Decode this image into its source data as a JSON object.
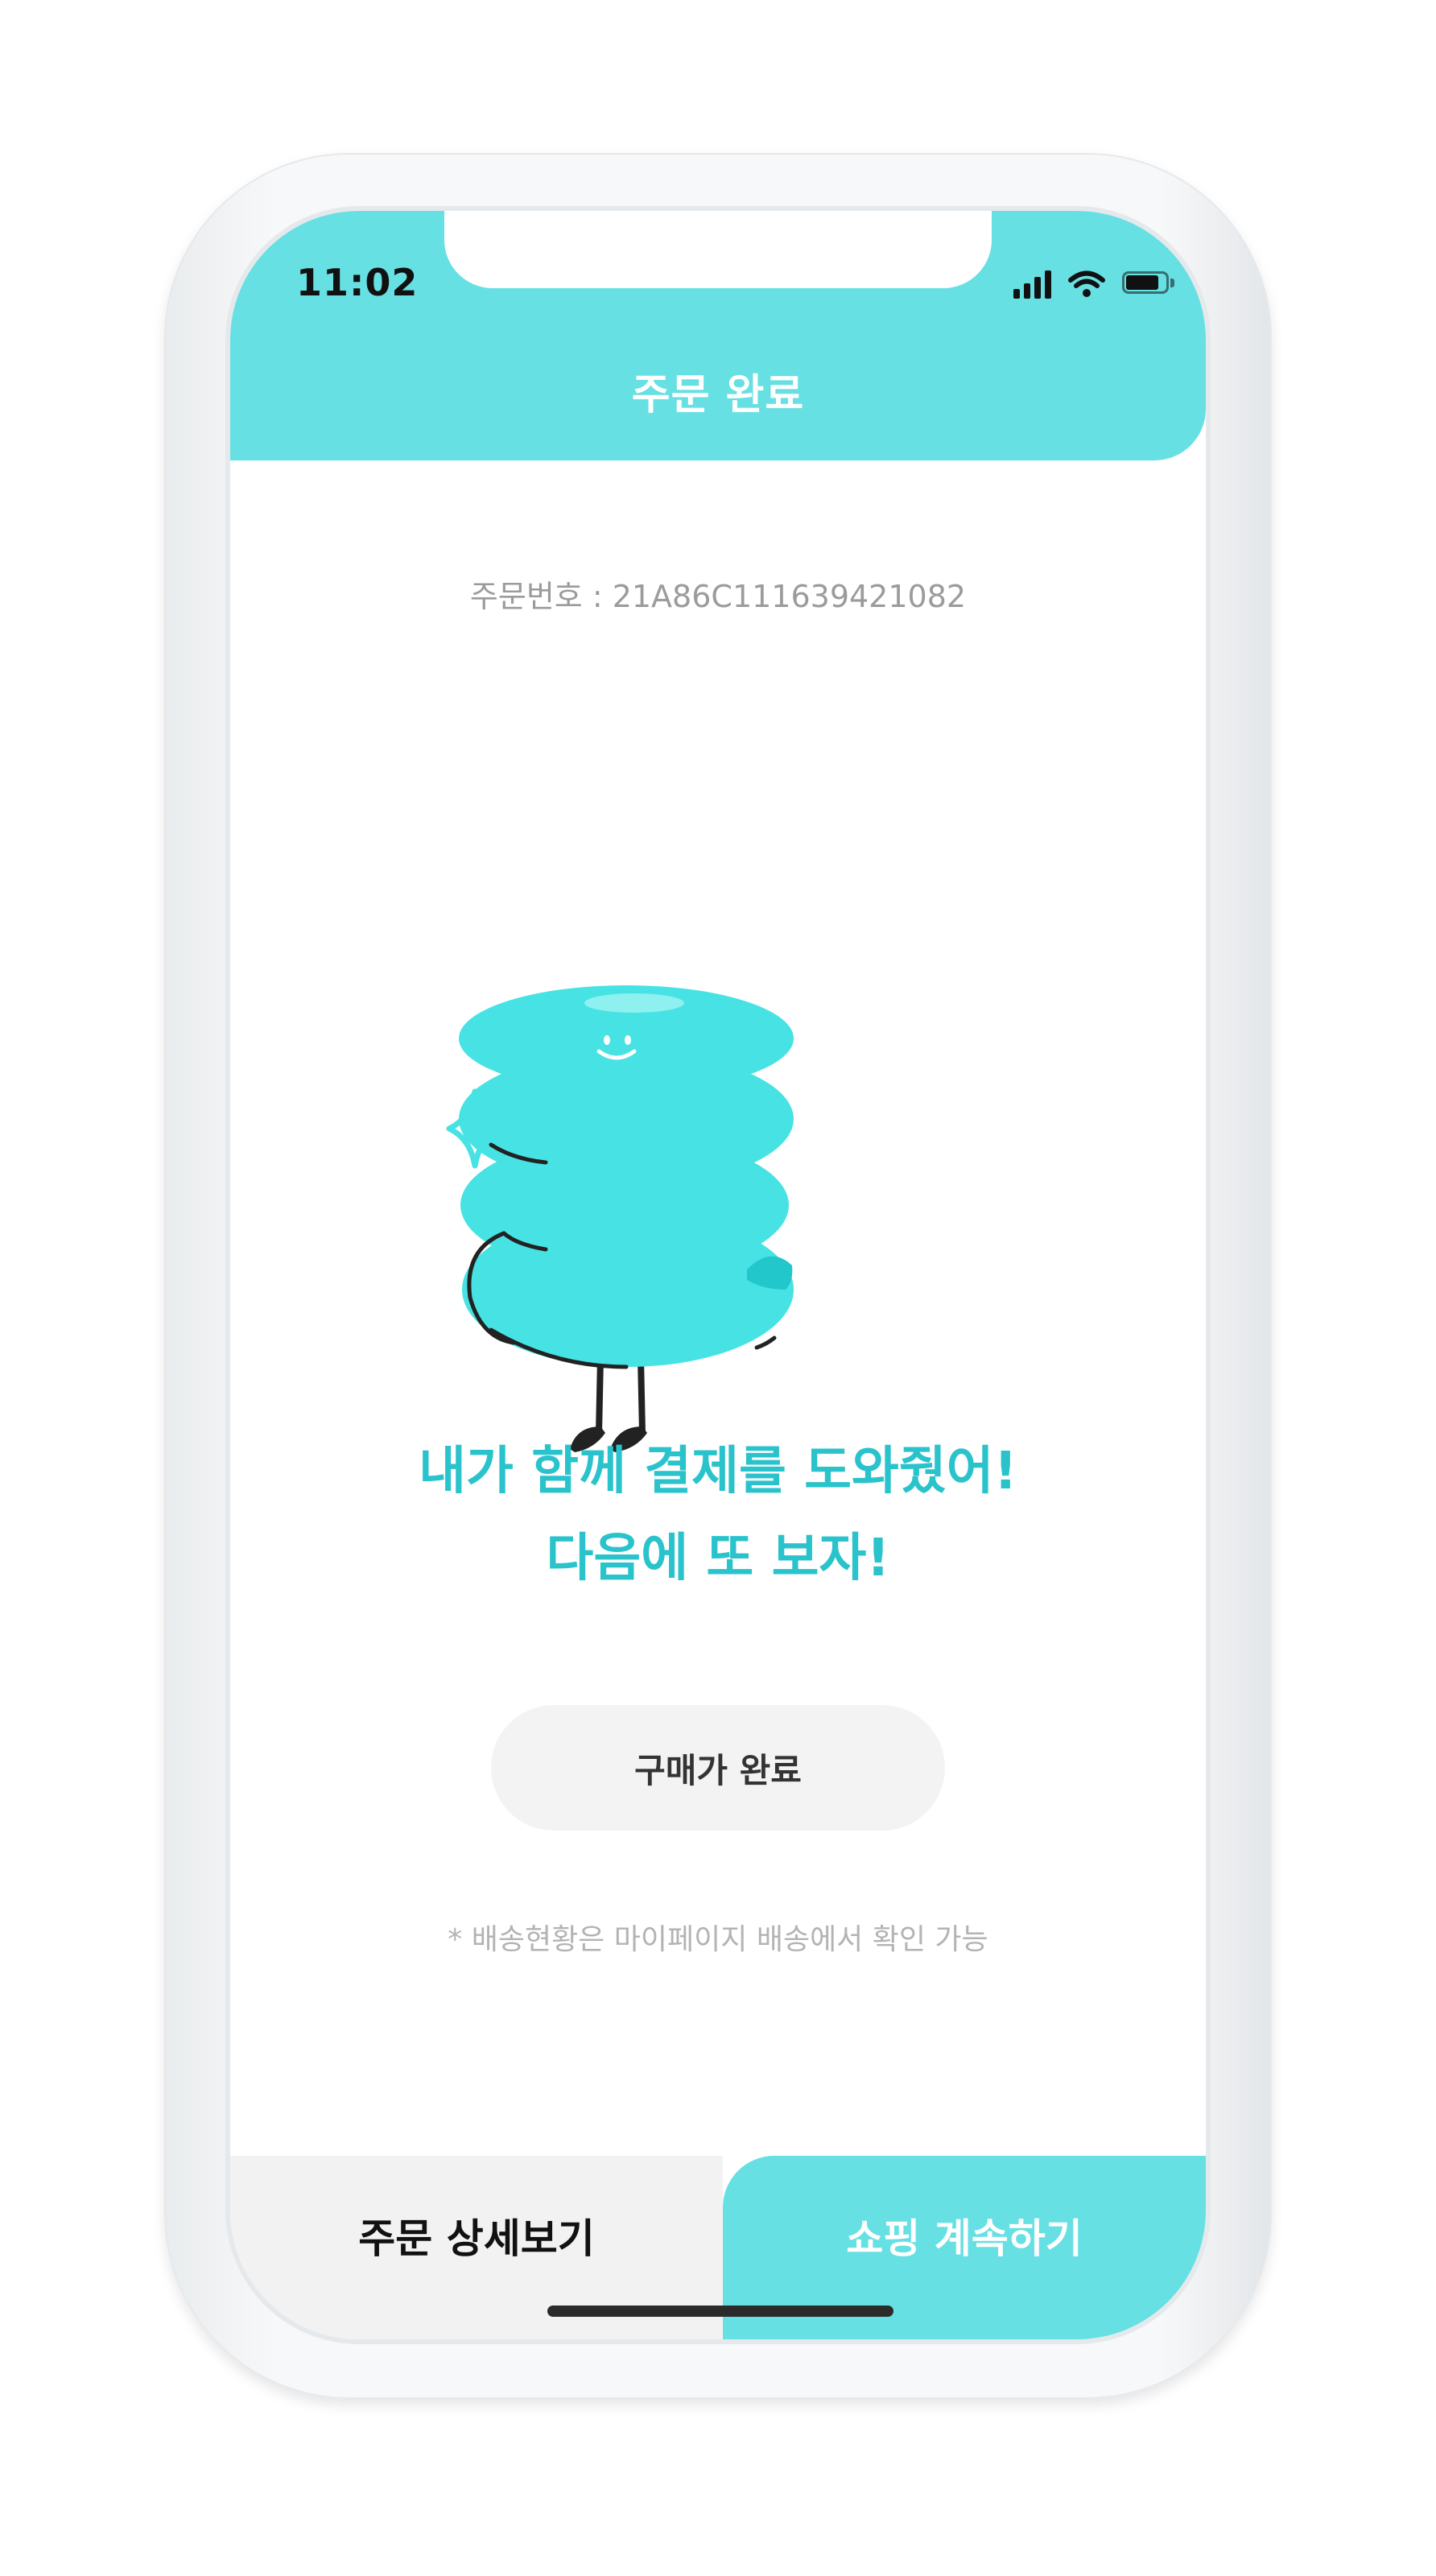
{
  "status_bar": {
    "time": "11:02",
    "icons": [
      "signal-icon",
      "wifi-icon",
      "battery-icon"
    ]
  },
  "header": {
    "title": "주문 완료"
  },
  "order": {
    "number_text": "주문번호 : 21A86C111639421082"
  },
  "illustration": {
    "name": "turquoise-stacked-mascot",
    "colors": {
      "body": "#47e2e3",
      "shade": "#22c7cc",
      "outline": "#222222",
      "sparkle": "#47e2e3"
    }
  },
  "message": {
    "line1": "내가 함께 결제를 도와줬어!",
    "line2": "다음에 또 보자!"
  },
  "complete_button": {
    "label": "구매가 완료"
  },
  "footnote": {
    "text": "* 배송현황은 마이페이지 배송에서 확인 가능"
  },
  "bottom_bar": {
    "detail_label": "주문 상세보기",
    "continue_label": "쇼핑 계속하기"
  },
  "colors": {
    "accent": "#66e0e3",
    "accent_text": "#2ac3cc",
    "muted_text": "#9b9b9b",
    "button_bg": "#f3f3f3"
  }
}
